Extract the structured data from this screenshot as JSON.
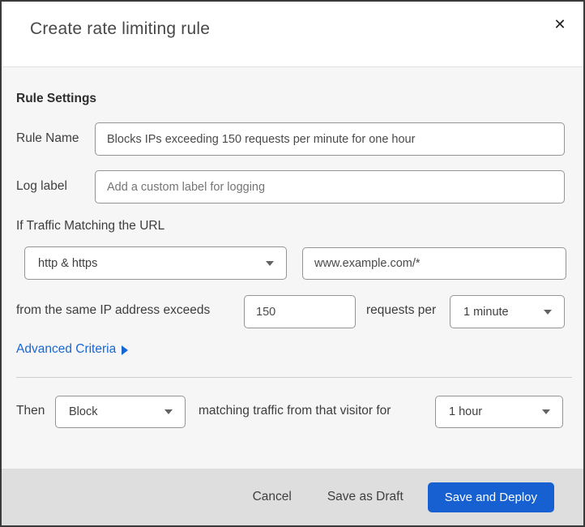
{
  "modal": {
    "title": "Create rate limiting rule",
    "close_glyph": "✕"
  },
  "form": {
    "section_heading": "Rule Settings",
    "rule_name": {
      "label": "Rule Name",
      "value": "Blocks IPs exceeding 150 requests per minute for one hour"
    },
    "log_label": {
      "label": "Log label",
      "placeholder": "Add a custom label for logging"
    },
    "traffic_match": {
      "heading": "If Traffic Matching the URL",
      "scheme_value": "http & https",
      "url_value": "www.example.com/*"
    },
    "threshold": {
      "prefix": "from the same IP address exceeds",
      "requests_value": "150",
      "middle": "requests per",
      "period_value": "1 minute"
    },
    "advanced_criteria_label": "Advanced Criteria",
    "action": {
      "prefix": "Then",
      "action_value": "Block",
      "middle": "matching traffic from that visitor for",
      "duration_value": "1 hour"
    }
  },
  "footer": {
    "cancel_label": "Cancel",
    "save_draft_label": "Save as Draft",
    "save_deploy_label": "Save and Deploy"
  },
  "colors": {
    "accent_blue": "#1660d2",
    "link_blue": "#1767d2",
    "body_bg": "#f6f6f6",
    "footer_bg": "#dedede",
    "backdrop_strip": "#0d1b28"
  }
}
